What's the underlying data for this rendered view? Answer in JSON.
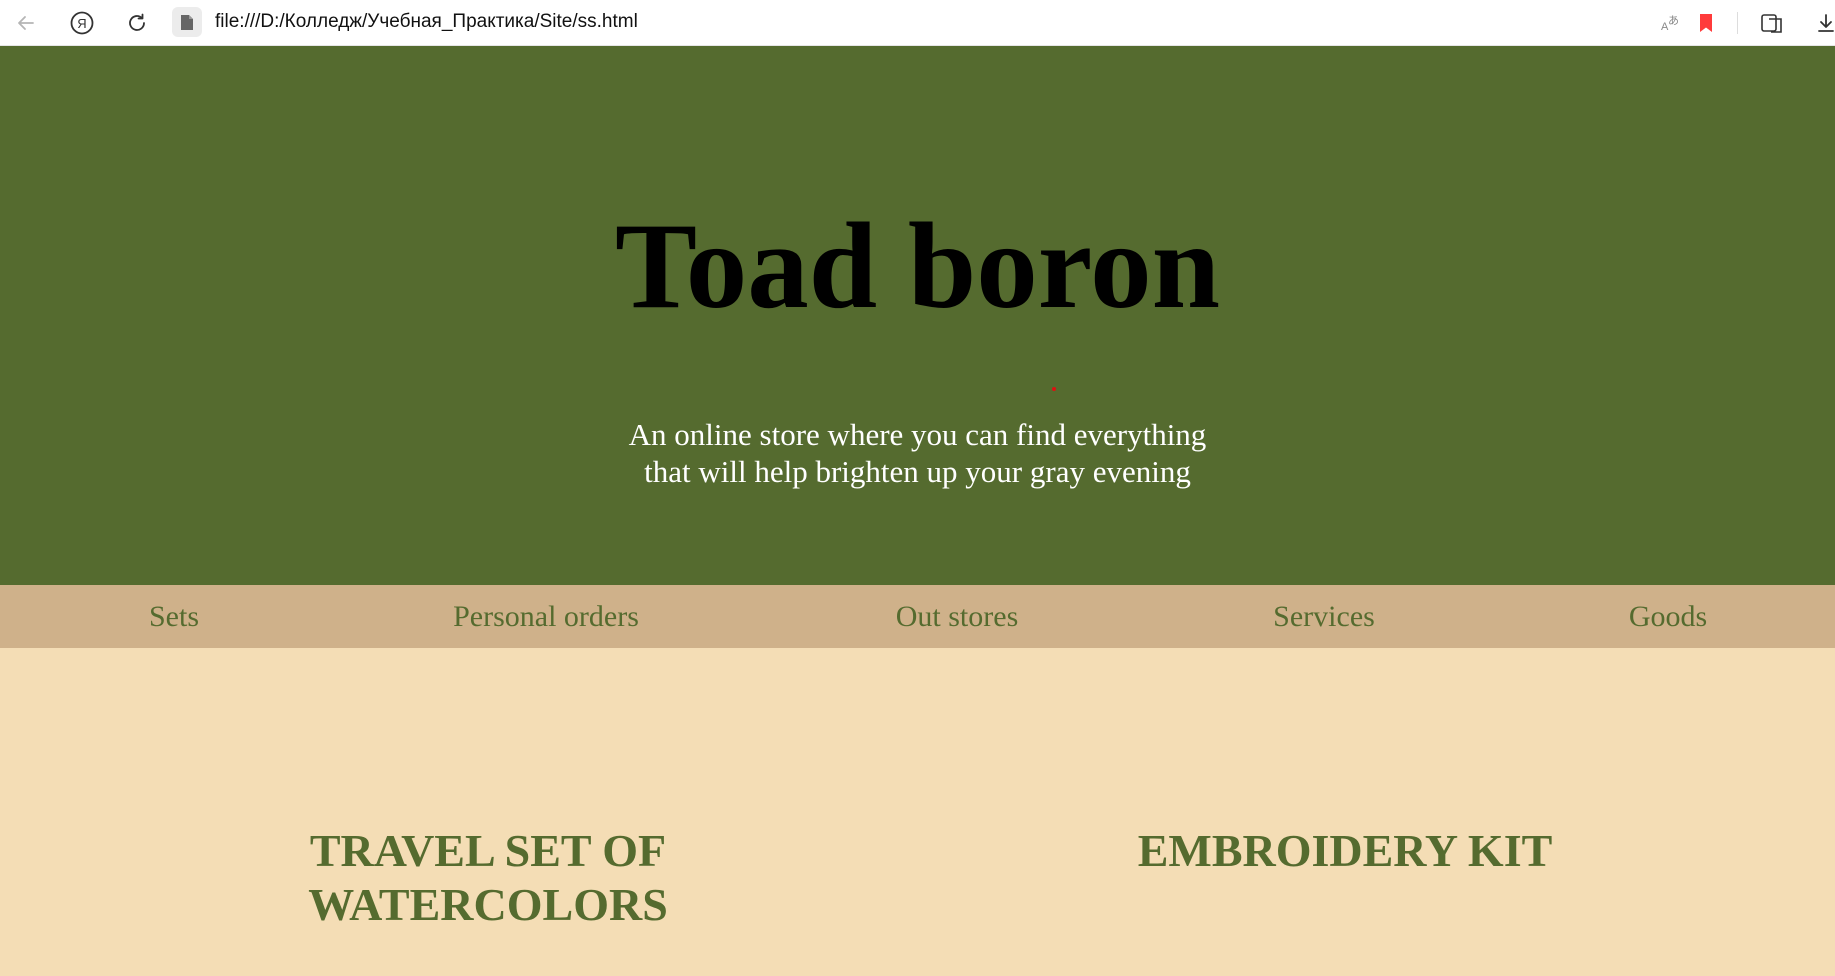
{
  "browser": {
    "url": "file:///D:/Колледж/Учебная_Практика/Site/ss.html",
    "icons": [
      "back-icon",
      "yandex-icon",
      "reload-icon",
      "file-icon",
      "translate-icon",
      "bookmark-icon",
      "reader-icon",
      "download-icon"
    ],
    "bookmark_color": "#ff3b3b"
  },
  "hero": {
    "title": "Toad boron",
    "subtitle_line1": "An online store where you can find everything",
    "subtitle_line2": "that will help brighten up your gray evening",
    "background_color": "#556b2f"
  },
  "nav": {
    "items": [
      {
        "label": "Sets"
      },
      {
        "label": "Personal orders"
      },
      {
        "label": "Out stores"
      },
      {
        "label": "Services"
      },
      {
        "label": "Goods"
      }
    ],
    "background_color": "#cfb18a",
    "text_color": "#556b2f"
  },
  "products": [
    {
      "title_line1": "TRAVEL SET OF",
      "title_line2": "WATERCOLORS"
    },
    {
      "title_line1": "EMBROIDERY KIT",
      "title_line2": ""
    }
  ],
  "page_background": "#f4ddb5"
}
